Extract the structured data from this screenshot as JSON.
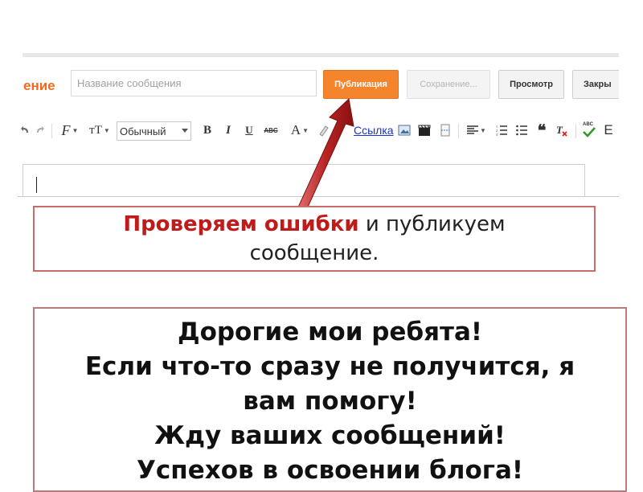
{
  "header": {
    "title_fragment": "ение",
    "post_title_placeholder": "Название сообщения",
    "publish_label": "Публикация",
    "save_label": "Сохранение...",
    "preview_label": "Просмотр",
    "close_label": "Закры"
  },
  "toolbar": {
    "font_glyph": "F",
    "font_size_glyph": "тT",
    "style_value": "Обычный",
    "bold_glyph": "B",
    "italic_glyph": "I",
    "underline_glyph": "U",
    "strike_glyph": "ABC",
    "text_color_glyph": "A",
    "link_label": "Ссылка",
    "quote_glyph": "❝",
    "spell_glyph": "ABC",
    "more_glyph": "E"
  },
  "callout": {
    "highlight": "Проверяем ошибки",
    "rest_line1": " и публикуем",
    "line2": "сообщение."
  },
  "message": {
    "lines": [
      "Дорогие мои ребята!",
      "Если что-то сразу не получится, я",
      "вам помогу!",
      "Жду ваших сообщений!",
      "Успехов в освоении блога!"
    ]
  },
  "colors": {
    "accent_orange": "#f5852d",
    "highlight_red": "#c01a1a",
    "arrow_red": "#b82424",
    "link_blue": "#1a33cc"
  }
}
